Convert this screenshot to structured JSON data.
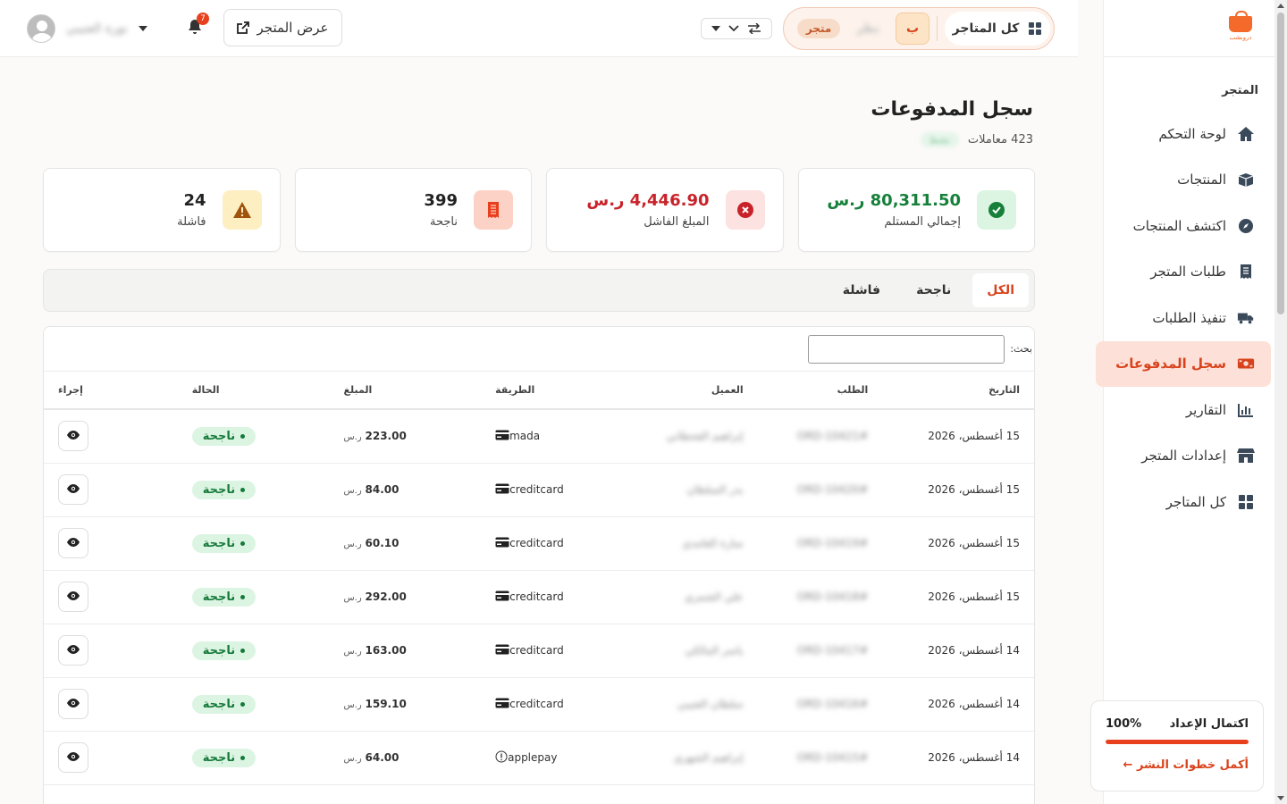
{
  "sidebar": {
    "logo_text": "دروبشب",
    "section_title": "المتجر",
    "items": [
      {
        "label": "لوحة التحكم",
        "icon": "home-icon"
      },
      {
        "label": "المنتجات",
        "icon": "box-icon"
      },
      {
        "label": "اكتشف المنتجات",
        "icon": "compass-icon"
      },
      {
        "label": "طلبات المتجر",
        "icon": "receipt-icon"
      },
      {
        "label": "تنفيذ الطلبات",
        "icon": "truck-icon"
      },
      {
        "label": "سجل المدفوعات",
        "icon": "money-icon",
        "active": true
      },
      {
        "label": "التقارير",
        "icon": "chart-icon"
      },
      {
        "label": "إعدادات المتجر",
        "icon": "store-icon"
      },
      {
        "label": "كل المتاجر",
        "icon": "grid-icon"
      }
    ],
    "setup": {
      "label": "اكتمال الإعداد",
      "percent_text": "100%",
      "percent": 100,
      "link": "أكمل خطوات النشر ←"
    }
  },
  "header": {
    "all_stores": "كل المتاجر",
    "chip_b": "ب",
    "chip_blur": "نظر",
    "chip_store": "متجر",
    "view_store": "عرض المتجر",
    "notifications_count": "7",
    "user_name": "نورة العتيبي"
  },
  "page": {
    "title": "سجل المدفوعات",
    "subtitle": "423 معاملات",
    "sub_pill": "نشط"
  },
  "stats": [
    {
      "value": "80,311.50 ر.س",
      "label": "إجمالي المستلم",
      "color": "#16803a",
      "bg": "#dcf5e3",
      "icon": "check-circle-icon"
    },
    {
      "value": "4,446.90 ر.س",
      "label": "المبلغ الفاشل",
      "color": "#c8232a",
      "bg": "#fde2e2",
      "icon": "x-circle-icon"
    },
    {
      "value": "399",
      "label": "ناجحة",
      "color": "#222",
      "bg": "#fcd2c6",
      "icon": "receipt-icon"
    },
    {
      "value": "24",
      "label": "فاشلة",
      "color": "#222",
      "bg": "#fdefc2",
      "icon": "warning-icon"
    }
  ],
  "tabs": [
    "الكل",
    "ناجحة",
    "فاشلة"
  ],
  "table": {
    "search_label": "بحث:",
    "columns": [
      "التاريخ",
      "الطلب",
      "العميل",
      "الطريقة",
      "المبلغ",
      "الحالة",
      "إجراء"
    ],
    "rows": [
      {
        "date": "15 أغسطس، 2026",
        "order": "#ORD-10421",
        "customer": "إبراهيم القحطاني",
        "method": "mada",
        "amount": "223.00",
        "currency": "ر.س",
        "status": "ناجحة",
        "method_icon": "card-icon"
      },
      {
        "date": "15 أغسطس، 2026",
        "order": "#ORD-10420",
        "customer": "بدر السلطان",
        "method": "creditcard",
        "amount": "84.00",
        "currency": "ر.س",
        "status": "ناجحة",
        "method_icon": "card-icon"
      },
      {
        "date": "15 أغسطس، 2026",
        "order": "#ORD-10419",
        "customer": "سارة الغامدي",
        "method": "creditcard",
        "amount": "60.10",
        "currency": "ر.س",
        "status": "ناجحة",
        "method_icon": "card-icon"
      },
      {
        "date": "15 أغسطس، 2026",
        "order": "#ORD-10418",
        "customer": "علي الشمري",
        "method": "creditcard",
        "amount": "292.00",
        "currency": "ر.س",
        "status": "ناجحة",
        "method_icon": "card-icon"
      },
      {
        "date": "14 أغسطس، 2026",
        "order": "#ORD-10417",
        "customer": "ياسر المالكي",
        "method": "creditcard",
        "amount": "163.00",
        "currency": "ر.س",
        "status": "ناجحة",
        "method_icon": "card-icon"
      },
      {
        "date": "14 أغسطس، 2026",
        "order": "#ORD-10416",
        "customer": "سلطان العتيبي",
        "method": "creditcard",
        "amount": "159.10",
        "currency": "ر.س",
        "status": "ناجحة",
        "method_icon": "card-icon"
      },
      {
        "date": "14 أغسطس، 2026",
        "order": "#ORD-10415",
        "customer": "إبراهيم الشهري",
        "method": "applepay",
        "amount": "64.00",
        "currency": "ر.س",
        "status": "ناجحة",
        "method_icon": "info-icon"
      }
    ]
  }
}
